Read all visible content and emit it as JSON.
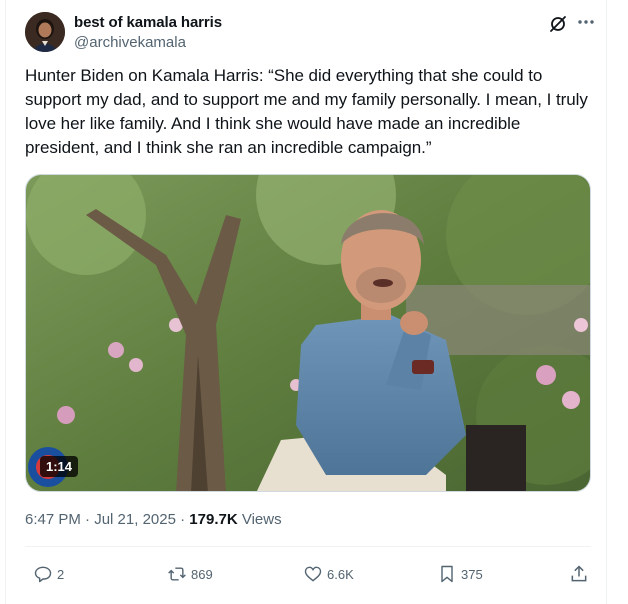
{
  "author": {
    "display_name": "best of kamala harris",
    "handle": "@archivekamala",
    "avatar_icon": "avatar-photo"
  },
  "header_icons": [
    "grok-icon",
    "more-icon"
  ],
  "tweet": {
    "text": "Hunter Biden on Kamala Harris: “She did everything that she could to support my dad, and to support me and my family personally. I mean, I truly love her like family. And I think she would have made an incredible president, and I think she ran an incredible campaign.”"
  },
  "media": {
    "duration": "1:14"
  },
  "meta": {
    "time": "6:47 PM",
    "sep1": " · ",
    "date": "Jul 21, 2025",
    "sep2": " · ",
    "views_count": "179.7K",
    "views_label": " Views"
  },
  "actions": {
    "replies": "2",
    "reposts": "869",
    "likes": "6.6K",
    "bookmarks": "375"
  },
  "colors": {
    "text": "#0f1419",
    "secondary": "#536471",
    "border": "#eff3f4"
  }
}
